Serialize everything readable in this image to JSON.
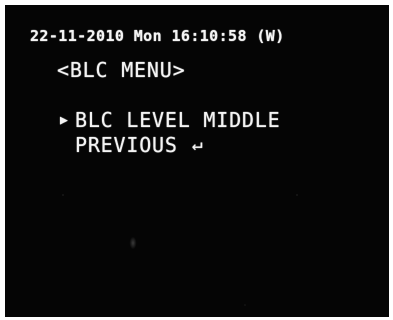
{
  "osd": {
    "status_line": "22-11-2010 Mon 16:10:58 (W)",
    "menu_title": "<BLC MENU>",
    "items": [
      {
        "label": "BLC LEVEL MIDDLE",
        "selected": true,
        "cursor_icon": "right-triangle-icon",
        "cursor_glyph": "▶"
      },
      {
        "label": "PREVIOUS",
        "selected": false,
        "trailing_icon": "enter-return-icon",
        "trailing_glyph": "↵"
      }
    ]
  },
  "colors": {
    "screen_background": "#050505",
    "osd_text": "#f4f4f4",
    "frame": "#ffffff"
  }
}
